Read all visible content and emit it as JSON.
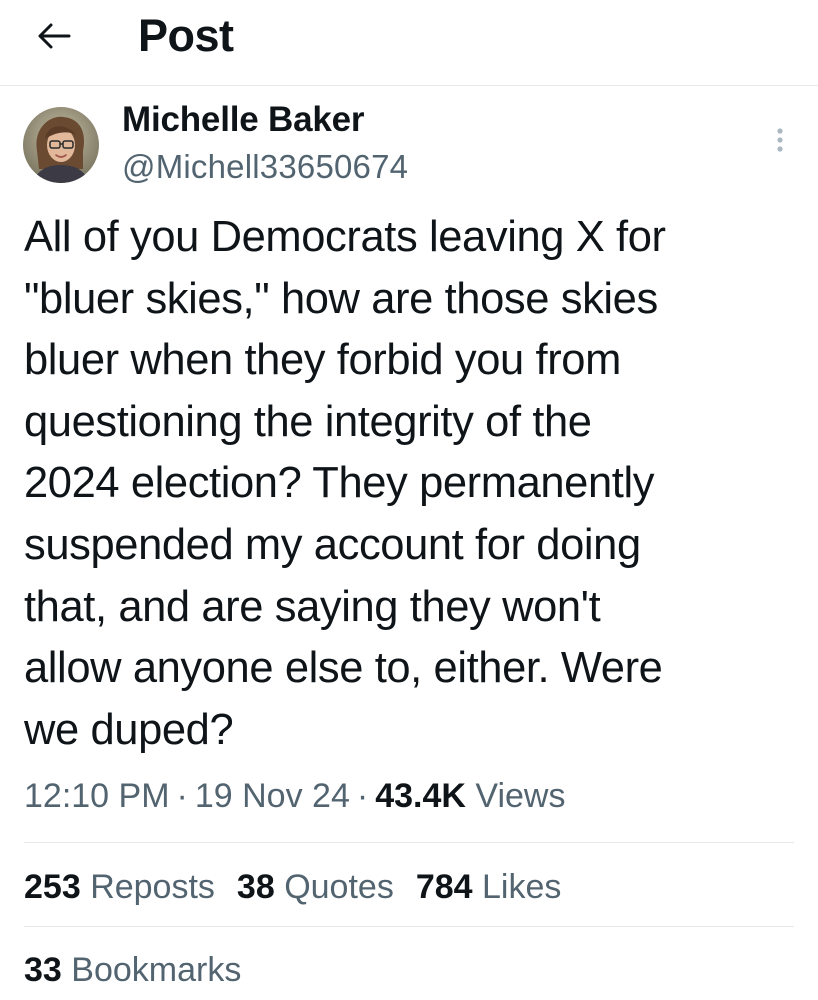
{
  "header": {
    "back_icon": "arrow-left-icon",
    "title": "Post"
  },
  "author": {
    "name": "Michelle Baker",
    "handle": "@Michell33650674",
    "avatar_icon": "user-avatar"
  },
  "post": {
    "lines": [
      "All of you Democrats leaving X for",
      "\"bluer skies,\" how are those skies",
      "bluer when they forbid you from",
      "questioning the integrity of the",
      "2024 election?  They permanently",
      "suspended my account for doing",
      "that, and are saying they won't",
      "allow anyone else to, either.  Were",
      "we duped?"
    ]
  },
  "meta": {
    "time": "12:10 PM",
    "date": "19 Nov 24",
    "separator": "·",
    "views_count": "43.4K",
    "views_label": "Views"
  },
  "stats": {
    "reposts_count": "253",
    "reposts_label": "Reposts",
    "quotes_count": "38",
    "quotes_label": "Quotes",
    "likes_count": "784",
    "likes_label": "Likes",
    "bookmarks_count": "33",
    "bookmarks_label": "Bookmarks"
  },
  "colors": {
    "text": "#0f1419",
    "secondary": "#536471",
    "divider": "#e6e9eb",
    "more_icon": "#aab8c2"
  }
}
